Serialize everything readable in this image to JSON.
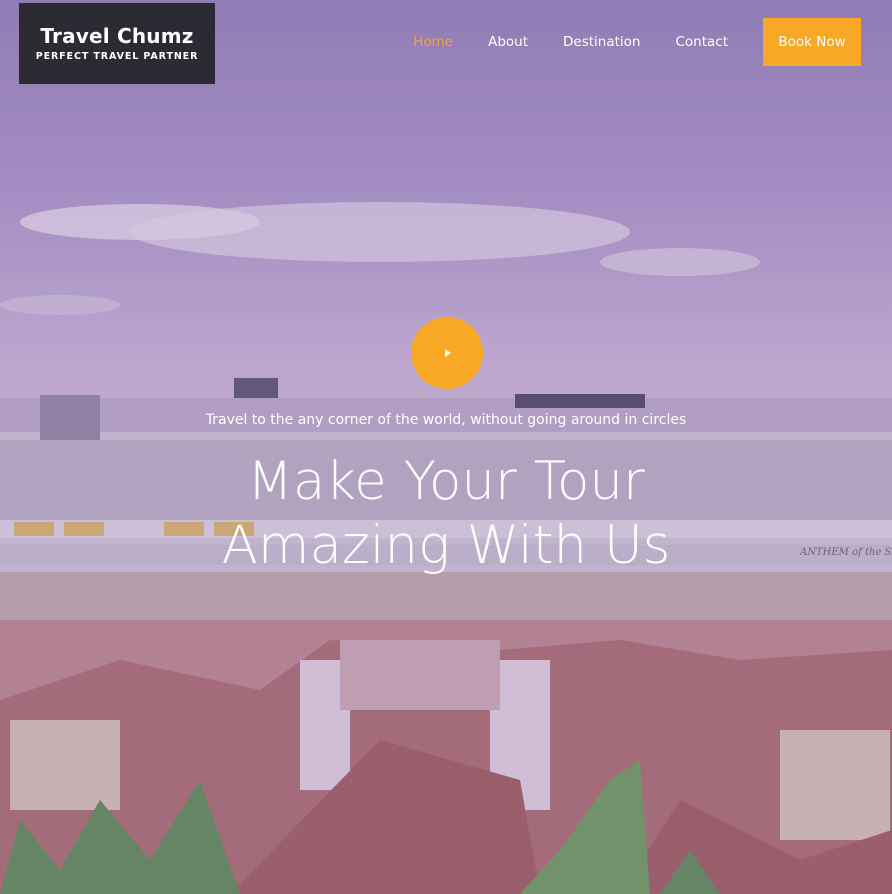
{
  "brand": {
    "name": "Travel Chumz",
    "tagline": "PERFECT TRAVEL PARTNER"
  },
  "nav": {
    "items": [
      {
        "label": "Home",
        "active": true
      },
      {
        "label": "About",
        "active": false
      },
      {
        "label": "Destination",
        "active": false
      },
      {
        "label": "Contact",
        "active": false
      }
    ],
    "cta": "Book Now"
  },
  "hero": {
    "subtitle": "Travel to the any corner of the world, without going around in circles",
    "headline_line1": "Make Your Tour",
    "headline_line2": "Amazing With Us",
    "ship_name": "ANTHEM of the SEAS"
  },
  "colors": {
    "accent": "#f9a825",
    "logo_bg": "#2c2a33",
    "nav_text": "#ffffff"
  },
  "icons": {
    "play": "play-icon"
  }
}
